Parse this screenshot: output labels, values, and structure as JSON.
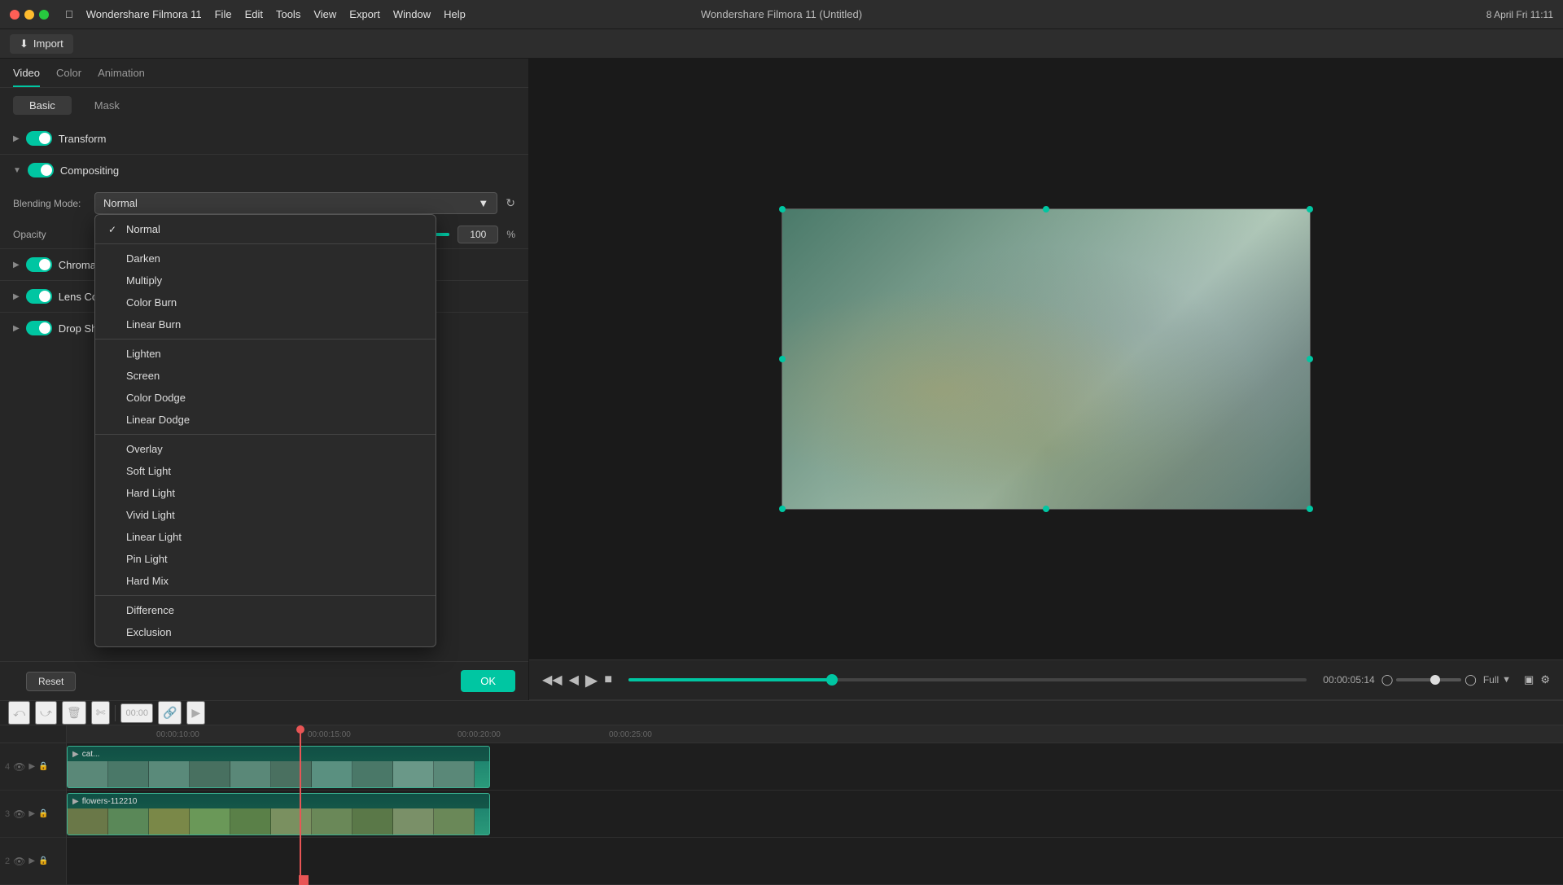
{
  "app": {
    "title": "Wondershare Filmora 11 (Untitled)"
  },
  "titlebar": {
    "menus": [
      "Apple",
      "Wondershare Filmora 11",
      "File",
      "Edit",
      "Tools",
      "View",
      "Export",
      "Window",
      "Help"
    ],
    "time": "8 April Fri 11:11",
    "import_label": " Import"
  },
  "panel": {
    "tabs": [
      "Video",
      "Color",
      "Animation"
    ],
    "active_tab": "Video",
    "sub_tabs": [
      "Basic",
      "Mask"
    ],
    "active_sub_tab": "Basic"
  },
  "sections": {
    "transform": {
      "label": "Transform",
      "enabled": true
    },
    "compositing": {
      "label": "Compositing",
      "enabled": true
    },
    "chroma_key": {
      "label": "Chroma Key",
      "enabled": true
    },
    "lens_correction": {
      "label": "Lens Correction",
      "enabled": true
    },
    "drop_shadow": {
      "label": "Drop Shadow",
      "enabled": true
    }
  },
  "blending": {
    "label": "Blending Mode:",
    "selected": "Normal",
    "options_group1": [
      {
        "label": "Normal",
        "selected": true
      }
    ],
    "options_group2": [
      {
        "label": "Darken"
      },
      {
        "label": "Multiply"
      },
      {
        "label": "Color Burn"
      },
      {
        "label": "Linear Burn"
      }
    ],
    "options_group3": [
      {
        "label": "Lighten"
      },
      {
        "label": "Screen"
      },
      {
        "label": "Color Dodge"
      },
      {
        "label": "Linear Dodge"
      }
    ],
    "options_group4": [
      {
        "label": "Overlay"
      },
      {
        "label": "Soft Light"
      },
      {
        "label": "Hard Light"
      },
      {
        "label": "Vivid Light"
      },
      {
        "label": "Linear Light"
      },
      {
        "label": "Pin Light"
      },
      {
        "label": "Hard Mix"
      }
    ],
    "options_group5": [
      {
        "label": "Difference"
      },
      {
        "label": "Exclusion"
      }
    ]
  },
  "opacity": {
    "label": "Opacity",
    "value": "100",
    "unit": "%"
  },
  "buttons": {
    "reset": "Reset",
    "ok": "OK"
  },
  "playback": {
    "duration": "00:00:05:14",
    "current_time": "00:00",
    "zoom_label": "Full"
  },
  "timeline": {
    "tracks": [
      {
        "num": "4",
        "clip_name": "cat..."
      },
      {
        "num": "3",
        "clip_name": "flowers-112210"
      },
      {
        "num": "2",
        "clip_name": ""
      }
    ],
    "time_markers": [
      "00:00:10:00",
      "00:00:15:00",
      "00:00:20:00",
      "00:00:25:00"
    ]
  }
}
